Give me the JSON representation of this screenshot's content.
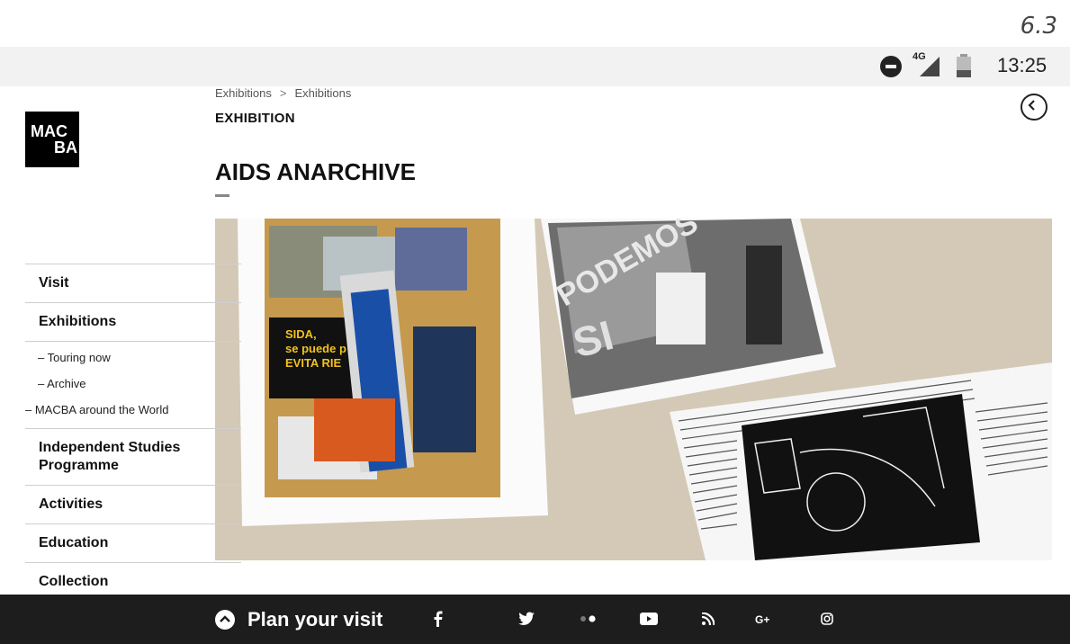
{
  "version_label": "6.3",
  "status_bar": {
    "network": "4G",
    "time": "13:25"
  },
  "logo": {
    "line1": "MAC",
    "line2": "BA"
  },
  "breadcrumb": {
    "items": [
      "Exhibitions",
      "Exhibitions"
    ],
    "separator": ">"
  },
  "page": {
    "kicker": "EXHIBITION",
    "title": "AIDS ANARCHIVE"
  },
  "sidebar": {
    "items": [
      {
        "label": "Visit"
      },
      {
        "label": "Exhibitions"
      }
    ],
    "subitems": [
      {
        "label": "– Touring now"
      },
      {
        "label": "– Archive"
      },
      {
        "label": "– MACBA around the World"
      }
    ],
    "items_after": [
      {
        "label": "Independent Studies Programme"
      },
      {
        "label": "Activities"
      },
      {
        "label": "Education"
      },
      {
        "label": "Collection"
      }
    ]
  },
  "hero": {
    "poster_lines": [
      "SIDA,",
      "se puede p",
      "EVITA RIE"
    ],
    "graffiti": [
      "PODEMOS",
      "SI"
    ]
  },
  "footer": {
    "plan_label": "Plan your visit",
    "social_icons": [
      "facebook-icon",
      "twitter-icon",
      "flickr-icon",
      "youtube-icon",
      "rss-icon",
      "google-plus-icon",
      "instagram-icon"
    ]
  },
  "colors": {
    "footer_bg": "#1d1d1d",
    "status_bar_bg": "#f2f2f2",
    "text": "#111111"
  }
}
